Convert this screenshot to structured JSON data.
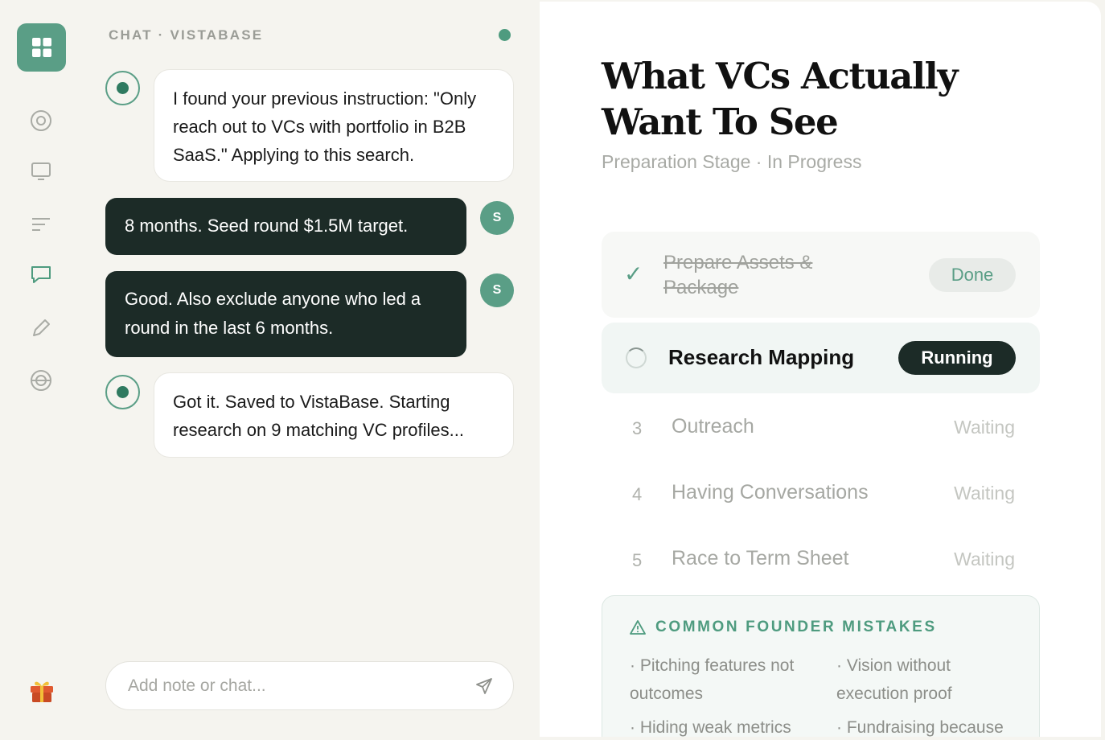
{
  "chat": {
    "header": "CHAT · VISTABASE",
    "messages": [
      {
        "role": "ai",
        "text": "I found your previous instruction: \"Only reach out to VCs with portfolio in B2B SaaS.\" Applying to this search."
      },
      {
        "role": "user",
        "avatar": "S",
        "text": "8 months. Seed round $1.5M target."
      },
      {
        "role": "user",
        "avatar": "S",
        "text": "Good. Also exclude anyone who led a round in the last 6 months."
      },
      {
        "role": "ai",
        "text": "Got it. Saved to VistaBase. Starting research on 9 matching VC profiles..."
      }
    ],
    "input_placeholder": "Add note or chat..."
  },
  "main": {
    "title": "What VCs Actually Want To See",
    "subtitle": "Preparation Stage · In Progress",
    "steps": [
      {
        "name": "Prepare Assets & Package",
        "status": "Done"
      },
      {
        "name": "Research Mapping",
        "status": "Running"
      },
      {
        "num": "3",
        "name": "Outreach",
        "status": "Waiting"
      },
      {
        "num": "4",
        "name": "Having Conversations",
        "status": "Waiting"
      },
      {
        "num": "5",
        "name": "Race to Term Sheet",
        "status": "Waiting"
      }
    ],
    "mistakes": {
      "title": "COMMON FOUNDER MISTAKES",
      "items": [
        "· Pitching features not outcomes",
        "· Vision without execution proof",
        "· Hiding weak metrics",
        "· Fundraising because"
      ]
    }
  },
  "colors": {
    "accent": "#5a9e86",
    "dark": "#1c2b27",
    "background": "#f5f4ef"
  }
}
